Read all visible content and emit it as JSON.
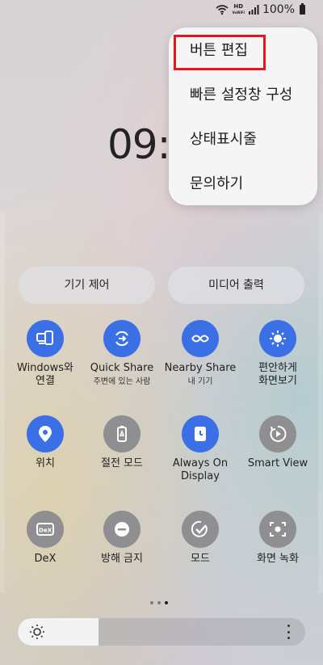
{
  "status_bar": {
    "hd_label_top": "HD",
    "hd_label_bottom": "VoWiFi",
    "battery": "100%"
  },
  "clock": {
    "time": "09:"
  },
  "menu": {
    "items": [
      {
        "label": "버튼 편집"
      },
      {
        "label": "빠른 설정창 구성"
      },
      {
        "label": "상태표시줄"
      },
      {
        "label": "문의하기"
      }
    ]
  },
  "pills": {
    "device_control": "기기 제어",
    "media_output": "미디어 출력"
  },
  "tiles": [
    {
      "label": "Windows와\n연결",
      "sub": "",
      "icon": "phone-pc-link-icon",
      "state": "on"
    },
    {
      "label": "Quick Share",
      "sub": "주변에 있는 사람",
      "icon": "quick-share-icon",
      "state": "on"
    },
    {
      "label": "Nearby Share",
      "sub": "내 기기",
      "icon": "nearby-share-icon",
      "state": "on"
    },
    {
      "label": "편안하게\n화면보기",
      "sub": "",
      "icon": "eye-comfort-icon",
      "state": "on"
    },
    {
      "label": "위치",
      "sub": "",
      "icon": "location-icon",
      "state": "on"
    },
    {
      "label": "절전 모드",
      "sub": "",
      "icon": "power-saving-icon",
      "state": "off"
    },
    {
      "label": "Always On\nDisplay",
      "sub": "",
      "icon": "always-on-display-icon",
      "state": "on"
    },
    {
      "label": "Smart View",
      "sub": "",
      "icon": "smart-view-icon",
      "state": "off"
    },
    {
      "label": "DeX",
      "sub": "",
      "icon": "dex-icon",
      "state": "off"
    },
    {
      "label": "방해 금지",
      "sub": "",
      "icon": "do-not-disturb-icon",
      "state": "off"
    },
    {
      "label": "모드",
      "sub": "",
      "icon": "modes-icon",
      "state": "off"
    },
    {
      "label": "화면 녹화",
      "sub": "",
      "icon": "screen-recorder-icon",
      "state": "off"
    }
  ],
  "pager": {
    "pages": 3,
    "active_index": 2
  },
  "brightness": {
    "level_fraction": 0.28
  },
  "colors": {
    "accent_on": "#3a6fe6",
    "icon_off": "#8f8f92",
    "highlight_box": "#e8141f"
  }
}
